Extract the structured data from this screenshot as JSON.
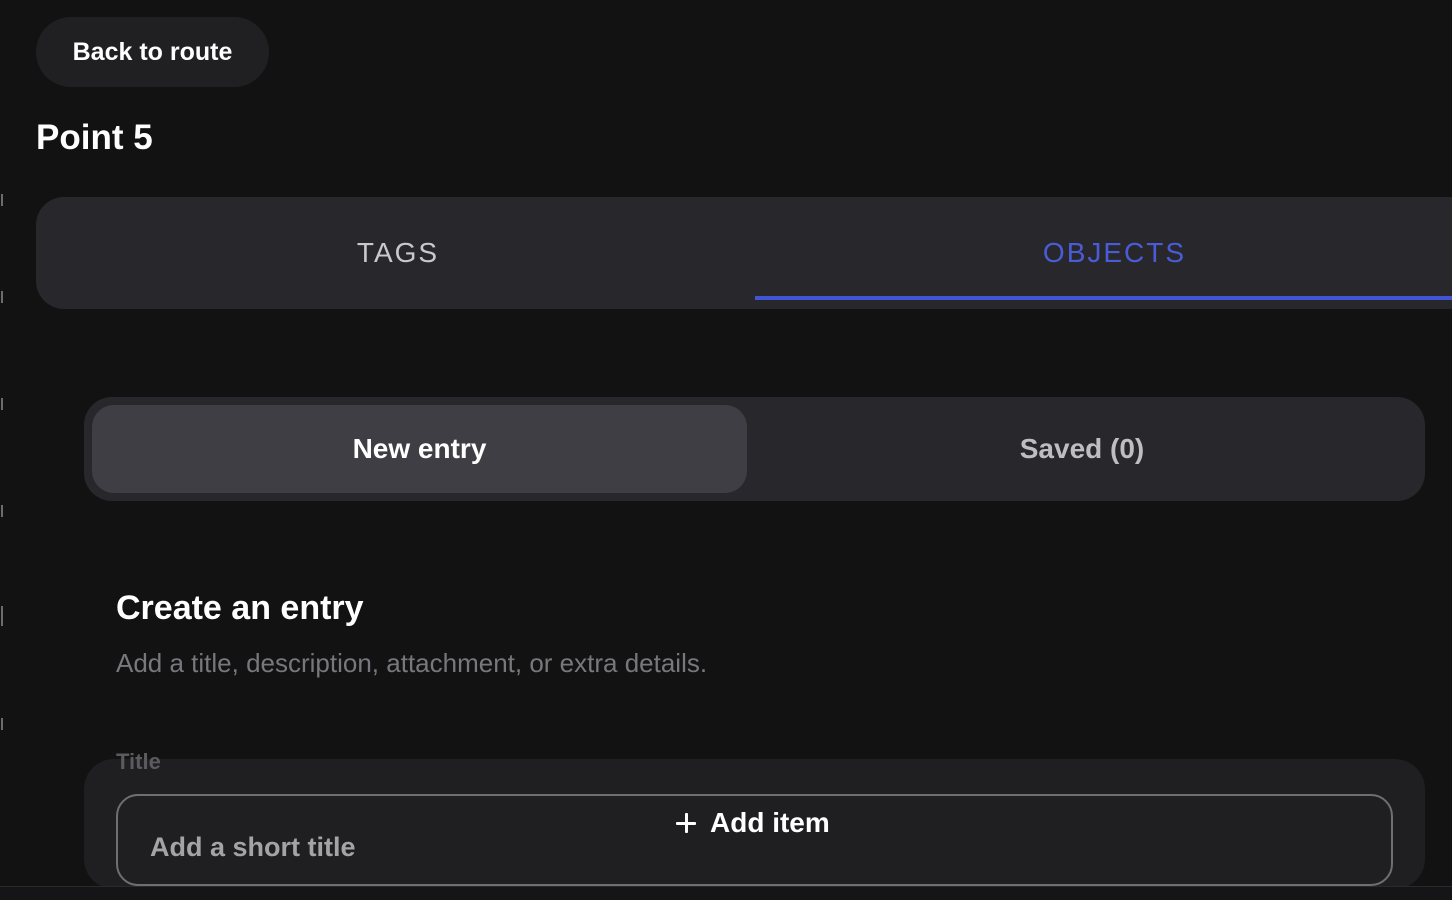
{
  "header": {
    "back_label": "Back to route",
    "point_title": "Point 5"
  },
  "tabs": [
    {
      "label": "TAGS",
      "active": false
    },
    {
      "label": "OBJECTS",
      "active": true
    }
  ],
  "segments": [
    {
      "label": "New entry",
      "active": true
    },
    {
      "label": "Saved (0)",
      "active": false
    }
  ],
  "form": {
    "title": "Create an entry",
    "subtitle": "Add a title, description, attachment, or extra details.",
    "title_label": "Title",
    "title_value": "",
    "title_placeholder": "Add a short title"
  },
  "add_item": {
    "label": "Add item",
    "icon": "plus-icon"
  },
  "colors": {
    "background": "#121213",
    "panel": "#28282c",
    "accent": "#4154d6",
    "active_segment": "#3e3e44"
  }
}
